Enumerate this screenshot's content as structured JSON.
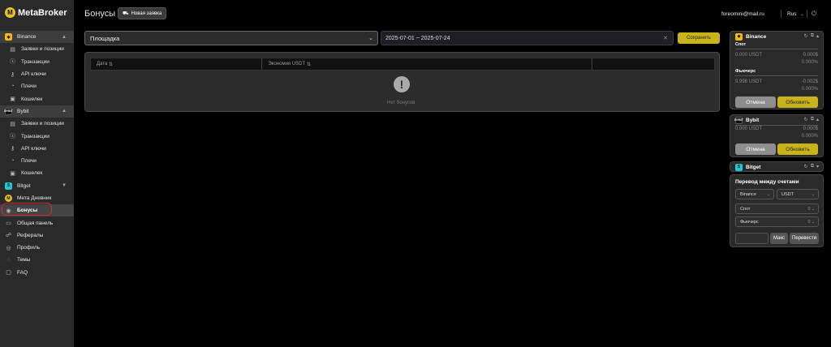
{
  "app": {
    "logo_letter": "M",
    "name": "MetaBroker"
  },
  "header": {
    "title": "Бонусы",
    "new_order_label": "Новая заявка",
    "user_email": "foreomini@mail.ru",
    "language": "Rus"
  },
  "sidebar": {
    "binance": {
      "label": "Binance",
      "items": [
        "Заявки и позиции",
        "Транзакции",
        "API ключи",
        "Плечи",
        "Кошелек"
      ]
    },
    "bybit": {
      "label": "Bybit",
      "items": [
        "Заявки и позиции",
        "Транзакции",
        "API ключи",
        "Плечи",
        "Кошелек"
      ]
    },
    "bitget": {
      "label": "Bitget"
    },
    "meta_diary": "Мета Дневник",
    "bonuses": "Бонусы",
    "dashboard": "Общая панель",
    "referrals": "Рефералы",
    "profile": "Профиль",
    "themes": "Темы",
    "faq": "FAQ"
  },
  "filters": {
    "platform_value": "Площадка",
    "date_range": "2025-07-01 ~ 2025-07-24",
    "save_label": "Сохранить"
  },
  "table": {
    "columns": [
      "Дата",
      "Экономия USDT",
      ""
    ],
    "empty_text": "Нет бонусов"
  },
  "accounts": {
    "binance": {
      "name": "Binance",
      "spot_label": "Спот",
      "spot_usdt": "0.000 USDT",
      "spot_usd": "0.000$",
      "spot_pct": "0.000%",
      "futures_label": "Фьючерс",
      "futures_usdt": "9.998 USDT",
      "futures_usd": "-0.002$",
      "futures_pct": "0.000%",
      "cancel": "Отмена",
      "update": "Обновить"
    },
    "bybit": {
      "name": "Bybit",
      "usdt": "0.000 USDT",
      "usd": "0.000$",
      "pct": "0.000%",
      "cancel": "Отмена",
      "update": "Обновить"
    },
    "bitget": {
      "name": "Bitget"
    }
  },
  "transfer": {
    "title": "Перевод между счетами",
    "exchange": "Binance",
    "currency": "USDT",
    "from_label": "Спот",
    "from_value": "0",
    "to_label": "Фьючерс",
    "to_value": "0",
    "max_label": "Макс",
    "transfer_label": "Перевести"
  },
  "colors": {
    "accent": "#c8b41a",
    "highlight": "#d4262c",
    "sidebar_bg": "#2a2a2a"
  }
}
